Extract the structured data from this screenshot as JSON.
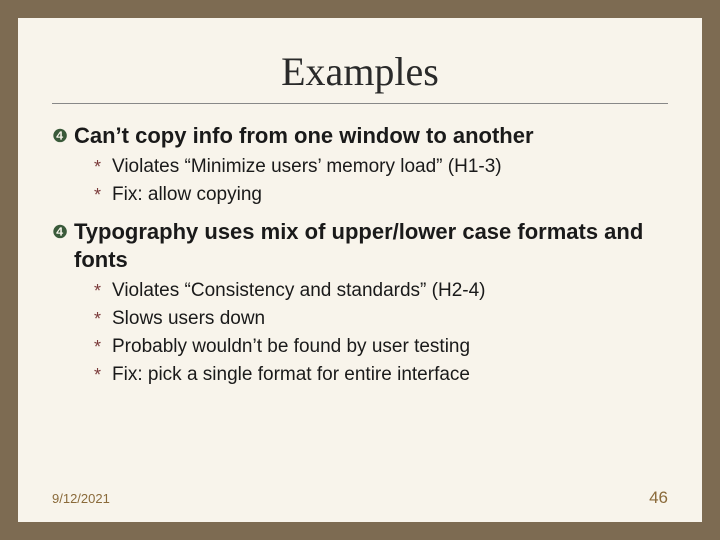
{
  "title": "Examples",
  "bullets": {
    "lvl1_glyph": "❹",
    "lvl2_glyph": "*"
  },
  "items": [
    {
      "text": "Can’t copy info from one window to another",
      "subs": [
        "Violates “Minimize users’ memory load” (H1-3)",
        "Fix: allow copying"
      ]
    },
    {
      "text": "Typography uses mix of upper/lower case formats and fonts",
      "subs": [
        "Violates “Consistency and standards” (H2-4)",
        "Slows users down",
        "Probably wouldn’t be found by user testing",
        "Fix: pick a single format for entire interface"
      ]
    }
  ],
  "footer": {
    "date": "9/12/2021",
    "page": "46"
  }
}
